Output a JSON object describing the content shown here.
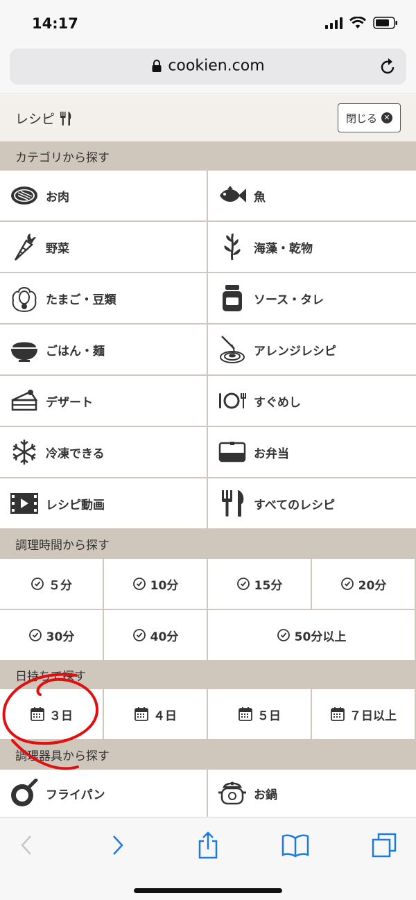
{
  "status": {
    "time": "14:17"
  },
  "browser": {
    "url": "cookien.com"
  },
  "menu": {
    "title": "レシピ",
    "close_label": "閉じる"
  },
  "sections": {
    "category": "カテゴリから探す",
    "cook_time": "調理時間から探す",
    "keep_days": "日持ちで探す",
    "tools": "調理器具から探す"
  },
  "categories": [
    {
      "label": "お肉",
      "icon": "meat-icon"
    },
    {
      "label": "魚",
      "icon": "fish-icon"
    },
    {
      "label": "野菜",
      "icon": "carrot-icon"
    },
    {
      "label": "海藻・乾物",
      "icon": "seaweed-icon"
    },
    {
      "label": "たまご・豆類",
      "icon": "egg-icon"
    },
    {
      "label": "ソース・タレ",
      "icon": "jar-icon"
    },
    {
      "label": "ごはん・麺",
      "icon": "rice-bowl-icon"
    },
    {
      "label": "アレンジレシピ",
      "icon": "pasta-icon"
    },
    {
      "label": "デザート",
      "icon": "cake-icon"
    },
    {
      "label": "すぐめし",
      "icon": "plate-icon"
    },
    {
      "label": "冷凍できる",
      "icon": "snowflake-icon"
    },
    {
      "label": "お弁当",
      "icon": "bento-icon"
    },
    {
      "label": "レシピ動画",
      "icon": "film-icon"
    },
    {
      "label": "すべてのレシピ",
      "icon": "cutlery-icon"
    }
  ],
  "cook_times": [
    "５分",
    "10分",
    "15分",
    "20分",
    "30分",
    "40分",
    "50分以上"
  ],
  "keep_days": [
    "３日",
    "４日",
    "５日",
    "７日以上"
  ],
  "tools": [
    {
      "label": "フライパン",
      "icon": "frying-pan-icon"
    },
    {
      "label": "お鍋",
      "icon": "pot-icon"
    }
  ],
  "colors": {
    "section_bg": "#cfc6bc",
    "header_bg": "#f3efea",
    "annotation": "#e01010",
    "link_blue": "#1a7ae2"
  }
}
